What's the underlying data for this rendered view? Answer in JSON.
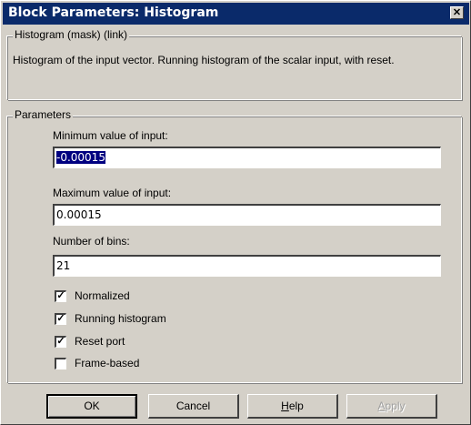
{
  "window": {
    "title": "Block Parameters: Histogram",
    "close_glyph": "✕"
  },
  "mask_group": {
    "legend": "Histogram (mask) (link)",
    "description": "Histogram of the input vector. Running histogram of the scalar input, with reset."
  },
  "parameters": {
    "legend": "Parameters",
    "min_label": "Minimum value of input:",
    "min_value": "-0.00015",
    "max_label": "Maximum  value of input:",
    "max_value": "0.00015",
    "bins_label": "Number of bins:",
    "bins_value": "21",
    "checkboxes": [
      {
        "label": "Normalized",
        "checked": true
      },
      {
        "label": "Running histogram",
        "checked": true
      },
      {
        "label": "Reset port",
        "checked": true
      },
      {
        "label": "Frame-based",
        "checked": false
      }
    ],
    "check_glyph": "✓"
  },
  "buttons": {
    "ok": "OK",
    "cancel": "Cancel",
    "help": "Help",
    "apply": "Apply"
  }
}
